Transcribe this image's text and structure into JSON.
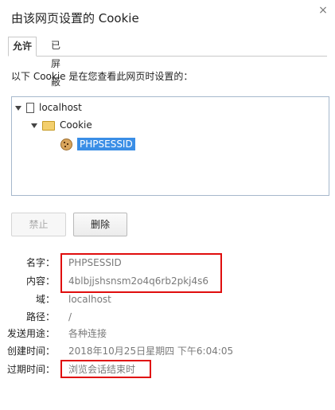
{
  "dialog": {
    "title": "由该网页设置的 Cookie",
    "close_glyph": "×"
  },
  "tabs": [
    {
      "label": "允许",
      "active": true
    },
    {
      "label": "已屏蔽",
      "active": false
    }
  ],
  "intro": "以下 Cookie 是在您查看此网页时设置的：",
  "tree": {
    "host": "localhost",
    "folder": "Cookie",
    "cookie": "PHPSESSID"
  },
  "buttons": {
    "block": "禁止",
    "remove": "删除"
  },
  "details": {
    "name_label": "名字：",
    "name_value": "PHPSESSID",
    "content_label": "内容：",
    "content_value": "4blbjjshsnsm2o4q6rb2pkj4s6",
    "domain_label": "域：",
    "domain_value": "localhost",
    "path_label": "路径：",
    "path_value": "/",
    "send_label": "发送用途：",
    "send_value": "各种连接",
    "created_label": "创建时间：",
    "created_value": "2018年10月25日星期四 下午6:04:05",
    "expires_label": "过期时间：",
    "expires_value": "浏览会话结束时"
  },
  "colors": {
    "highlight": "#e00d0d",
    "selection": "#3a8ee6",
    "tree_border": "#a6b8cc"
  }
}
